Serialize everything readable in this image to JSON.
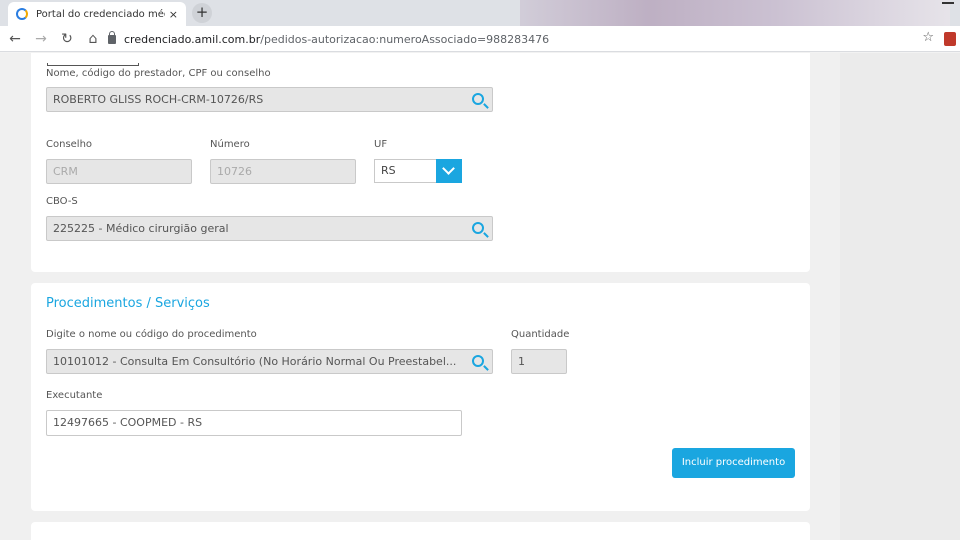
{
  "browser": {
    "tab_title": "Portal do credenciado médico",
    "tab_close": "×",
    "new_tab": "+",
    "url_host": "credenciado.amil.com.br",
    "url_path": "/pedidos-autorizacao:numeroAssociado=988283476"
  },
  "prestador": {
    "label": "Nome, código do prestador, CPF ou conselho",
    "value": "ROBERTO GLISS ROCH-CRM-10726/RS",
    "conselho_label": "Conselho",
    "conselho_value": "CRM",
    "numero_label": "Número",
    "numero_value": "10726",
    "uf_label": "UF",
    "uf_value": "RS",
    "cbo_label": "CBO-S",
    "cbo_value": "225225 - Médico cirurgião geral"
  },
  "procedimentos": {
    "title": "Procedimentos / Serviços",
    "proc_label": "Digite o nome ou código do procedimento",
    "proc_value": "10101012 - Consulta Em Consultório (No Horário Normal Ou Preestabel...",
    "quantidade_label": "Quantidade",
    "quantidade_value": "1",
    "executante_label": "Executante",
    "executante_value": "12497665 - COOPMED - RS",
    "incluir_label": "Incluir procedimento"
  },
  "colors": {
    "accent": "#1aa6e0"
  }
}
